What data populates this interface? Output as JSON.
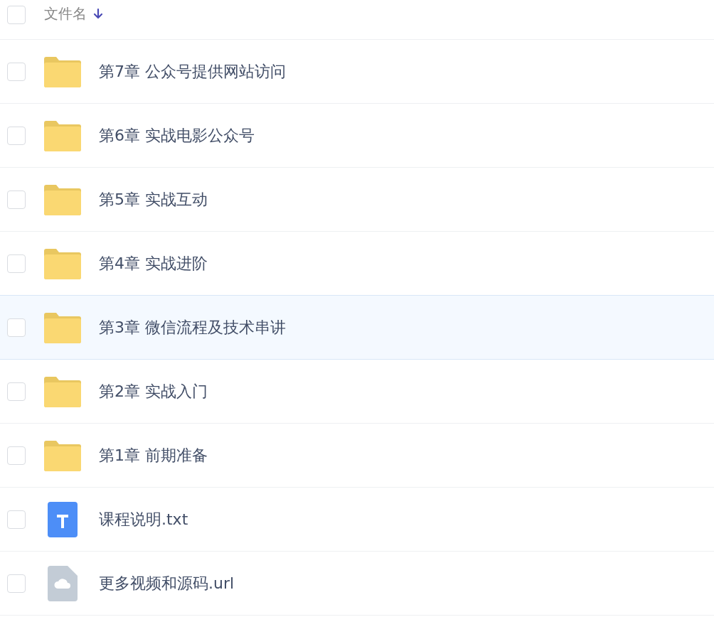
{
  "header": {
    "checked": false,
    "label": "文件名",
    "sort_descending": true
  },
  "rows": [
    {
      "name": "第7章 公众号提供网站访问",
      "kind": "folder",
      "checked": false,
      "highlighted": false
    },
    {
      "name": "第6章 实战电影公众号",
      "kind": "folder",
      "checked": false,
      "highlighted": false
    },
    {
      "name": "第5章 实战互动",
      "kind": "folder",
      "checked": false,
      "highlighted": false
    },
    {
      "name": "第4章 实战进阶",
      "kind": "folder",
      "checked": false,
      "highlighted": false
    },
    {
      "name": "第3章 微信流程及技术串讲",
      "kind": "folder",
      "checked": false,
      "highlighted": true
    },
    {
      "name": "第2章 实战入门",
      "kind": "folder",
      "checked": false,
      "highlighted": false
    },
    {
      "name": "第1章 前期准备",
      "kind": "folder",
      "checked": false,
      "highlighted": false
    },
    {
      "name": "课程说明.txt",
      "kind": "txt",
      "checked": false,
      "highlighted": false
    },
    {
      "name": "更多视频和源码.url",
      "kind": "url",
      "checked": false,
      "highlighted": false
    }
  ]
}
